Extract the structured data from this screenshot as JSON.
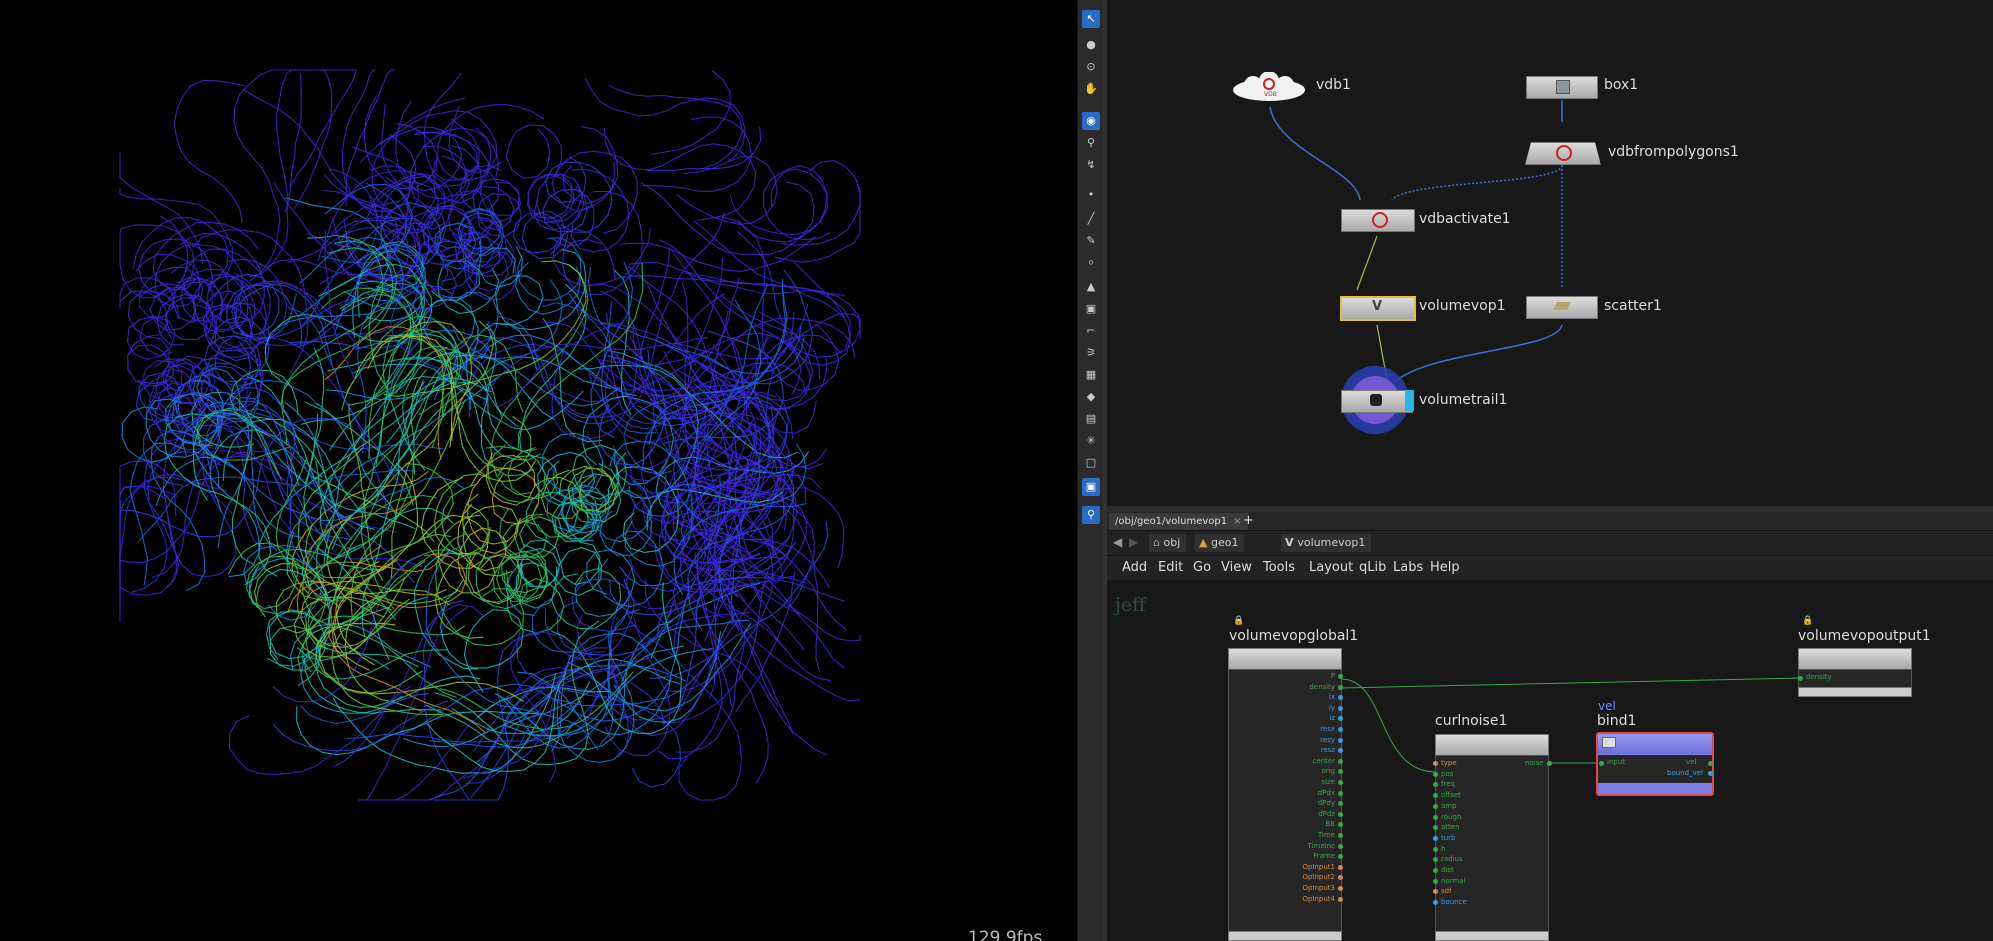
{
  "viewport": {
    "fps": "129.9fps"
  },
  "toolbar": {
    "tools": [
      "cursor-icon",
      "light-icon",
      "camera-icon",
      "hand-icon",
      "display-icon",
      "snap-icon",
      "handle-icon",
      "point-icon",
      "pen-icon",
      "brush-icon",
      "number-icon",
      "paint-icon",
      "stamp-icon",
      "bracket-icon",
      "ruler-icon",
      "grid-icon",
      "cube-icon",
      "texture-icon",
      "node-icon",
      "box-icon",
      "camera-view-icon",
      "pin-icon"
    ]
  },
  "network_top": {
    "nodes": [
      {
        "name": "vdb1",
        "icon": "vdb-cloud-icon"
      },
      {
        "name": "box1",
        "icon": "box-icon"
      },
      {
        "name": "vdbfrompolygons1",
        "icon": "vdb-icon"
      },
      {
        "name": "vdbactivate1",
        "icon": "vdb-icon"
      },
      {
        "name": "volumevop1",
        "icon": "vop-icon"
      },
      {
        "name": "scatter1",
        "icon": "scatter-icon"
      },
      {
        "name": "volumetrail1",
        "icon": "trail-icon"
      }
    ]
  },
  "network_bottom": {
    "tab": {
      "label": "/obj/geo1/volumevop1",
      "close": "×"
    },
    "add_tab": "+",
    "breadcrumbs": [
      "obj",
      "geo1",
      "volumevop1"
    ],
    "menu": [
      "Add",
      "Edit",
      "Go",
      "View",
      "Tools",
      "Layout",
      "qLib",
      "Labs",
      "Help"
    ],
    "sticky_text": "jeff",
    "global_node": {
      "title": "volumevopglobal1",
      "ports": [
        "P",
        "density",
        "ix",
        "iy",
        "iz",
        "resx",
        "resy",
        "resz",
        "center",
        "orig",
        "size",
        "dPdx",
        "dPdy",
        "dPdz",
        "BB",
        "Time",
        "TimeInc",
        "Frame",
        "OpInput1",
        "OpInput2",
        "OpInput3",
        "OpInput4"
      ]
    },
    "output_node": {
      "title": "volumevopoutput1",
      "ports": [
        "density"
      ]
    },
    "curlnoise_node": {
      "title": "curlnoise1",
      "inputs": [
        "type",
        "pos",
        "freq",
        "offset",
        "amp",
        "rough",
        "atten",
        "turb",
        "h",
        "radius",
        "dist",
        "normal",
        "sdf",
        "bounce"
      ],
      "output": "noise"
    },
    "bind_node": {
      "subtitle": "vel",
      "title": "bind1",
      "input": "input",
      "outputs": [
        "vel",
        "bound_vel"
      ]
    },
    "colors": {
      "float_port": "#3aa64a",
      "vector_port": "#3b9de0",
      "string_port": "#d88a4a",
      "wire_selected": "#3b8dff",
      "bind_header": "#7f7fe8",
      "bind_border": "#e0484a",
      "display_flag": "#2fb3e8"
    }
  }
}
